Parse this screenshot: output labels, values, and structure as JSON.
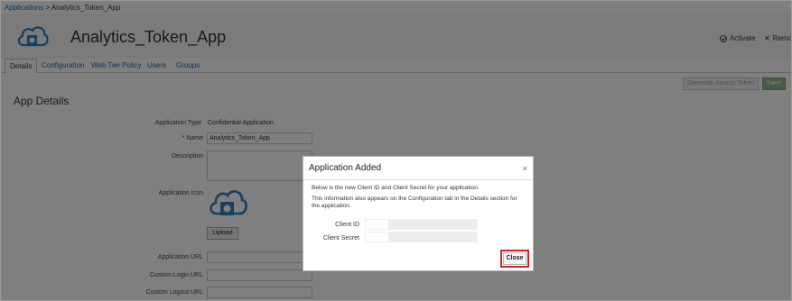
{
  "breadcrumb": {
    "root": "Applications",
    "separator": ">",
    "current": "Analytics_Token_App"
  },
  "header": {
    "app_title": "Analytics_Token_App",
    "activate_label": "Activate",
    "remove_label": "Remov"
  },
  "tabs": [
    {
      "label": "Details",
      "active": true
    },
    {
      "label": "Configuration",
      "active": false
    },
    {
      "label": "Web Tier Policy",
      "active": false
    },
    {
      "label": "Users",
      "active": false
    },
    {
      "label": "Groups",
      "active": false
    }
  ],
  "toolbar": {
    "generate_label": "Generate Access Token",
    "save_label": "Save"
  },
  "section_title": "App Details",
  "form": {
    "app_type_label": "Application Type",
    "app_type_value": "Confidential Application",
    "name_label": "Name",
    "name_required": "*",
    "name_value": "Analytics_Token_App",
    "description_label": "Description",
    "icon_label": "Application Icon",
    "upload_label": "Upload",
    "app_url_label": "Application URL",
    "custom_login_label": "Custom Login URL",
    "custom_logout_label": "Custom Logout URL"
  },
  "dialog": {
    "title": "Application Added",
    "close_icon": "×",
    "text1": "Below is the new Client ID and Client Secret for your application.",
    "text2": "This information also appears on the Configuration tab in the Details section for the application.",
    "client_id_label": "Client ID",
    "client_secret_label": "Client Secret",
    "close_label": "Close"
  },
  "colors": {
    "link": "#1f66b0",
    "save_button": "#8fb98c",
    "highlight": "#c62828"
  },
  "icons": {
    "app_logo": "cloud-app-icon",
    "activate": "check-circle-icon",
    "remove": "x-icon"
  }
}
